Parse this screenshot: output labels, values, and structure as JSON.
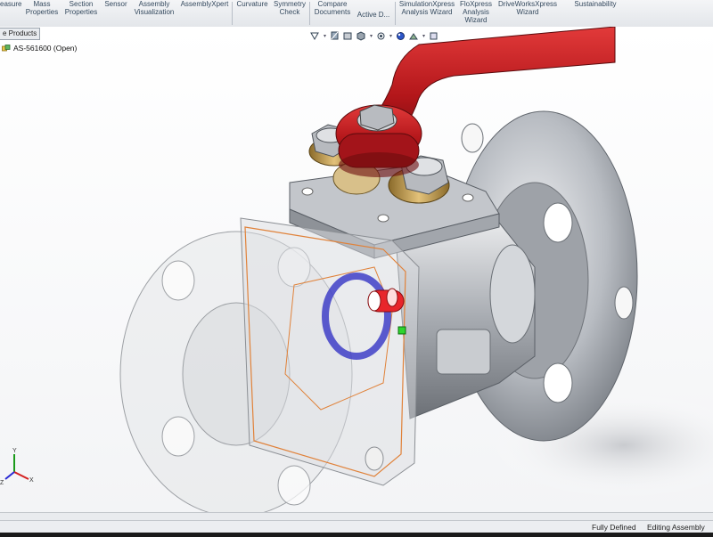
{
  "ribbon": {
    "buttons": [
      {
        "id": "measure",
        "label": "easure"
      },
      {
        "id": "mass",
        "label": "Mass\nProperties"
      },
      {
        "id": "section",
        "label": "Section\nProperties"
      },
      {
        "id": "sensor",
        "label": "Sensor"
      },
      {
        "id": "asmviz",
        "label": "Assembly\nVisualization"
      },
      {
        "id": "asmx",
        "label": "AssemblyXpert"
      },
      {
        "id": "curvature",
        "label": "Curvature"
      },
      {
        "id": "symmetry",
        "label": "Symmetry\nCheck"
      },
      {
        "id": "compare",
        "label": "Compare\nDocuments"
      },
      {
        "id": "activedoc",
        "label": "Active D..."
      },
      {
        "id": "simx",
        "label": "SimulationXpress\nAnalysis Wizard"
      },
      {
        "id": "flox",
        "label": "FloXpress\nAnalysis\nWizard"
      },
      {
        "id": "dwx",
        "label": "DriveWorksXpress\nWizard"
      },
      {
        "id": "sust",
        "label": "Sustainability"
      }
    ]
  },
  "tree": {
    "tab_label": "e Products",
    "root_item": "AS-561600  (Open)"
  },
  "status": {
    "defined": "Fully Defined",
    "mode": "Editing Assembly"
  },
  "triad": {
    "x": "X",
    "y": "Y",
    "z": "Z"
  },
  "colors": {
    "handle": "#c0161a",
    "steel": "#a9adb3",
    "brass": "#c9a35a",
    "seat": "#2b2bb8"
  }
}
